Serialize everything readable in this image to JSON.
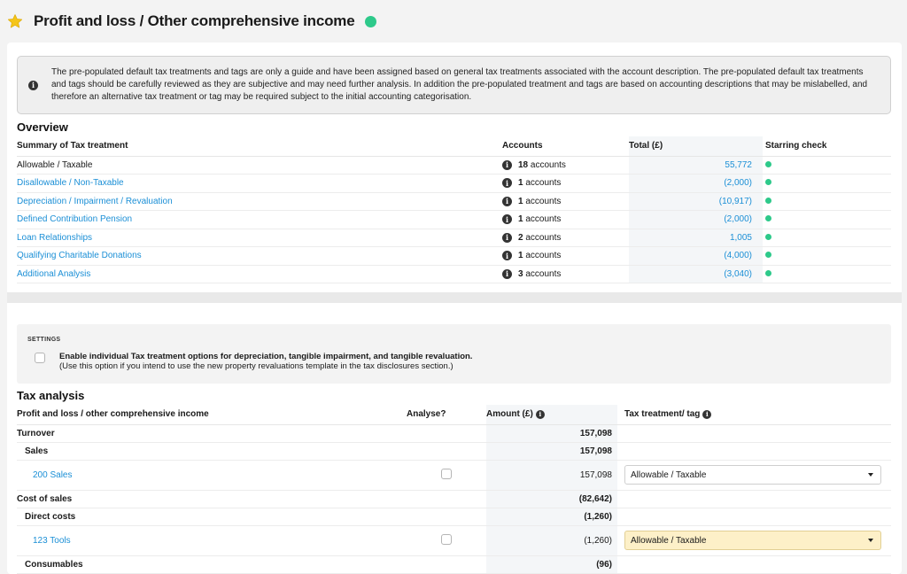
{
  "header": {
    "title": "Profit and loss / Other comprehensive income"
  },
  "notice": {
    "text": "The pre-populated default tax treatments and tags are only a guide and have been assigned based on general tax treatments associated with the account description. The pre-populated default tax treatments and tags should be carefully reviewed as they are subjective and may need further analysis. In addition the pre-populated treatment and tags are based on accounting descriptions that may be mislabelled, and therefore an alternative tax treatment or tag may be required subject to the initial accounting categorisation."
  },
  "overview": {
    "title": "Overview",
    "columns": {
      "treatment": "Summary of Tax treatment",
      "accounts": "Accounts",
      "total": "Total (£)",
      "starring": "Starring check"
    },
    "rows": [
      {
        "label": "Allowable / Taxable",
        "accounts_count": "18",
        "accounts_unit": "accounts",
        "total": "55,772"
      },
      {
        "label": "Disallowable / Non-Taxable",
        "accounts_count": "1",
        "accounts_unit": "accounts",
        "total": "(2,000)"
      },
      {
        "label": "Depreciation / Impairment / Revaluation",
        "accounts_count": "1",
        "accounts_unit": "accounts",
        "total": "(10,917)"
      },
      {
        "label": "Defined Contribution Pension",
        "accounts_count": "1",
        "accounts_unit": "accounts",
        "total": "(2,000)"
      },
      {
        "label": "Loan Relationships",
        "accounts_count": "2",
        "accounts_unit": "accounts",
        "total": "1,005"
      },
      {
        "label": "Qualifying Charitable Donations",
        "accounts_count": "1",
        "accounts_unit": "accounts",
        "total": "(4,000)"
      },
      {
        "label": "Additional Analysis",
        "accounts_count": "3",
        "accounts_unit": "accounts",
        "total": "(3,040)"
      }
    ]
  },
  "settings": {
    "label": "SETTINGS",
    "option_title": "Enable individual Tax treatment options for depreciation, tangible impairment, and tangible revaluation.",
    "option_note": "(Use this option if you intend to use the new property revaluations template in the tax disclosures section.)"
  },
  "tax_analysis": {
    "title": "Tax analysis",
    "columns": {
      "item": "Profit and loss / other comprehensive income",
      "analyse": "Analyse?",
      "amount": "Amount (£)",
      "tag": "Tax treatment/ tag"
    },
    "rows": [
      {
        "label": "Turnover",
        "amount": "157,098"
      },
      {
        "label": "Sales",
        "amount": "157,098"
      },
      {
        "label": "200 Sales",
        "amount": "157,098",
        "treatment": "Allowable / Taxable"
      },
      {
        "label": "Cost of sales",
        "amount": "(82,642)"
      },
      {
        "label": "Direct costs",
        "amount": "(1,260)"
      },
      {
        "label": "123 Tools",
        "amount": "(1,260)",
        "treatment": "Allowable / Taxable"
      },
      {
        "label": "Consumables",
        "amount": "(96)"
      }
    ]
  },
  "colors": {
    "accent": "#1b8fd6",
    "status_ok": "#2dc98a",
    "star": "#f5c518",
    "highlight": "#fdf0c8"
  }
}
